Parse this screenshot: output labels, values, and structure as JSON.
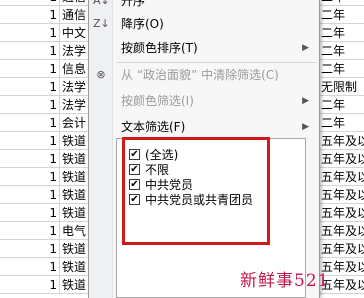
{
  "sheet": {
    "rows": [
      {
        "num": "1",
        "dept": "通信",
        "len": "二年"
      },
      {
        "num": "1",
        "dept": "通信",
        "len": "二年"
      },
      {
        "num": "1",
        "dept": "中文",
        "len": "二年"
      },
      {
        "num": "1",
        "dept": "法学",
        "len": "二年"
      },
      {
        "num": "1",
        "dept": "信息",
        "len": "二年"
      },
      {
        "num": "1",
        "dept": "法学",
        "len": "无限制"
      },
      {
        "num": "1",
        "dept": "法学",
        "len": "二年"
      },
      {
        "num": "1",
        "dept": "会计",
        "len": "二年"
      },
      {
        "num": "1",
        "dept": "铁道",
        "len": "五年及以"
      },
      {
        "num": "1",
        "dept": "铁道",
        "len": "五年及以"
      },
      {
        "num": "1",
        "dept": "铁道",
        "len": "五年及以"
      },
      {
        "num": "1",
        "dept": "铁道",
        "len": "五年及以"
      },
      {
        "num": "1",
        "dept": "铁道",
        "len": "五年及以"
      },
      {
        "num": "1",
        "dept": "电气",
        "len": "五年及以"
      },
      {
        "num": "1",
        "dept": "铁道",
        "len": "五年及以"
      },
      {
        "num": "1",
        "dept": "铁道",
        "len": "五年及以"
      },
      {
        "num": "1",
        "dept": "铁道",
        "len": "五年及以"
      }
    ]
  },
  "menu": {
    "sort_asc": "升序",
    "sort_desc": "降序(O)",
    "sort_by_color": "按颜色排序(T)",
    "clear_filter": "从 “政治面貌” 中清除筛选(C)",
    "filter_by_color": "按颜色筛选(I)",
    "text_filter": "文本筛选(F)",
    "submenu_arrow": "▶"
  },
  "filter_list": {
    "items": [
      {
        "label": "(全选)",
        "checked": "✔"
      },
      {
        "label": "不限",
        "checked": "✔"
      },
      {
        "label": "中共党员",
        "checked": "✔"
      },
      {
        "label": "中共党员或共青团员",
        "checked": "✔"
      }
    ]
  },
  "watermark": "新鲜事521"
}
